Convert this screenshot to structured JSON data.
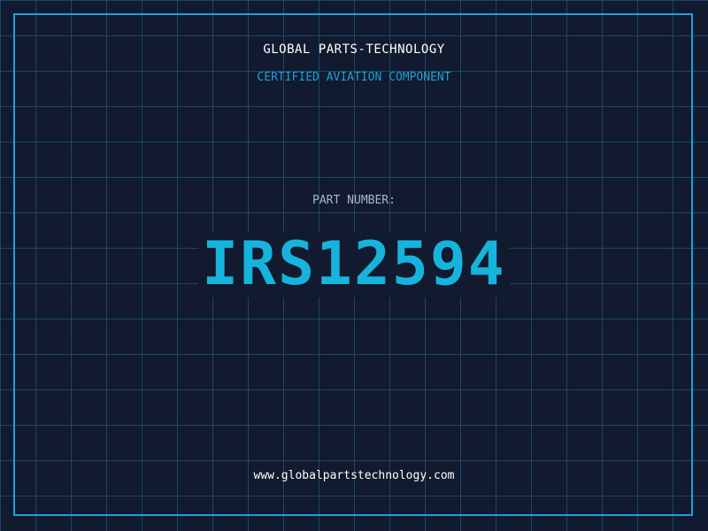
{
  "header": {
    "company": "GLOBAL PARTS-TECHNOLOGY",
    "subtitle": "CERTIFIED AVIATION COMPONENT"
  },
  "part": {
    "label": "PART NUMBER:",
    "number": "IRS12594"
  },
  "footer": {
    "url": "www.globalpartstechnology.com"
  },
  "colors": {
    "background": "#111a2e",
    "grid": "#236e96",
    "accent": "#1da2d6",
    "part_number": "#16b4dc",
    "label": "#a9b6c8",
    "text": "#ffffff"
  }
}
